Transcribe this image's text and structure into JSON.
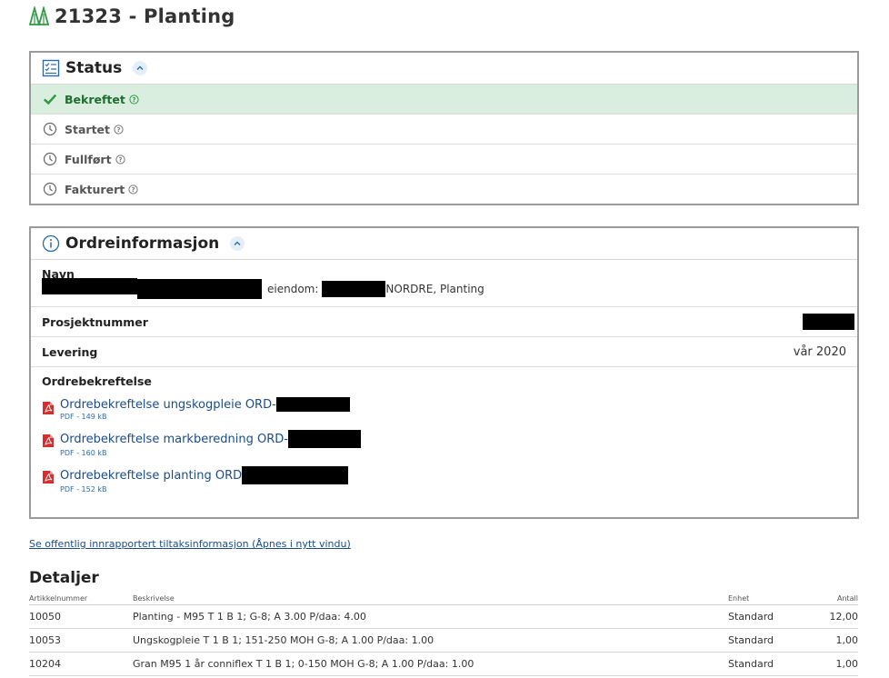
{
  "page": {
    "title": "21323 - Planting"
  },
  "status": {
    "heading": "Status",
    "items": [
      {
        "label": "Bekreftet",
        "state": "done"
      },
      {
        "label": "Startet",
        "state": "pending"
      },
      {
        "label": "Fullført",
        "state": "pending"
      },
      {
        "label": "Fakturert",
        "state": "pending"
      }
    ]
  },
  "order_info": {
    "heading": "Ordreinformasjon",
    "navn_label": "Navn",
    "navn_mid": "eiendom:",
    "navn_end": "NORDRE, Planting",
    "project_label": "Prosjektnummer",
    "delivery_label": "Levering",
    "delivery_value": "vår 2020",
    "confirm_label": "Ordrebekreftelse",
    "documents": [
      {
        "title": "Ordrebekreftelse ungskogpleie ORD-",
        "size": "PDF - 149 kB"
      },
      {
        "title": "Ordrebekreftelse markberedning ORD-",
        "size": "PDF - 160 kB"
      },
      {
        "title": "Ordrebekreftelse planting ORD",
        "size": "PDF - 152 kB"
      }
    ]
  },
  "public_link": "Se offentlig innrapportert tiltaksinformasjon (Åpnes i nytt vindu)",
  "details": {
    "heading": "Detaljer",
    "columns": [
      "Artikkelnummer",
      "Beskrivelse",
      "Enhet",
      "Antall"
    ],
    "rows": [
      [
        "10050",
        "Planting - M95 T 1 B 1; G-8; A 3.00 P/daa: 4.00",
        "Standard",
        "12,00"
      ],
      [
        "10053",
        "Ungskogpleie T 1 B 1; 151-250 MOH G-8; A 1.00 P/daa: 1.00",
        "Standard",
        "1,00"
      ],
      [
        "10204",
        "Gran M95 1 år conniflex T 1 B 1; 0-150 MOH G-8; A 1.00 P/daa: 1.00",
        "Standard",
        "1,00"
      ]
    ]
  },
  "colors": {
    "accent_green": "#2f9a44",
    "active_row": "#d9eedf",
    "link_blue": "#1a4c8c",
    "pdf_red": "#d32f2f"
  }
}
